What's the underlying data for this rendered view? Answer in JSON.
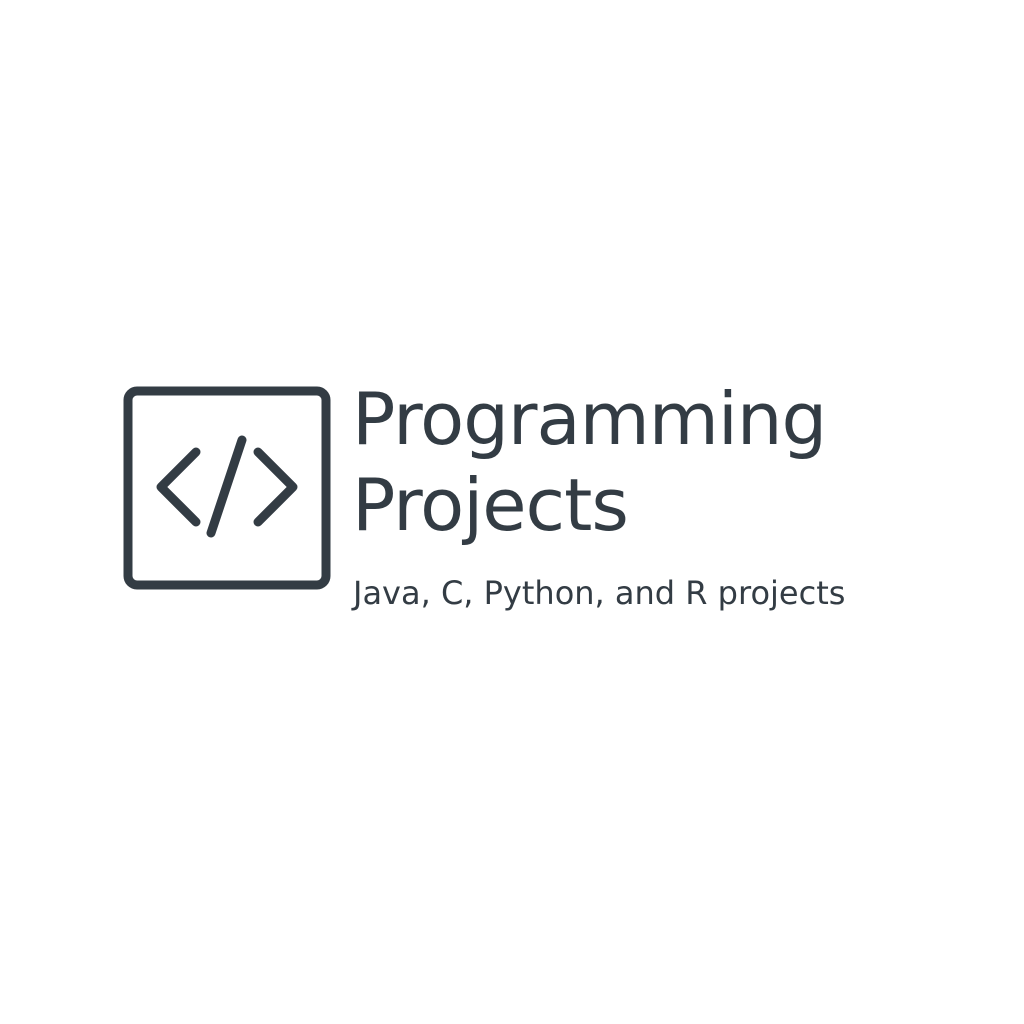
{
  "logo": {
    "icon": "code-brackets-icon",
    "color": "#333c44"
  },
  "title": {
    "line1": "Programming",
    "line2": "Projects"
  },
  "tagline": "Java, C, Python, and R projects",
  "colors": {
    "background": "#ffffff",
    "ink": "#333c44"
  }
}
